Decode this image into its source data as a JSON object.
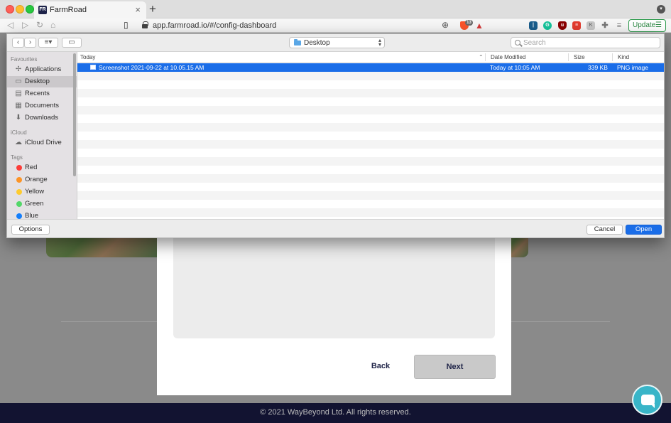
{
  "browser": {
    "tab": {
      "favicon": "FR",
      "title": "FarmRoad",
      "close": "×"
    },
    "new_tab": "+",
    "url": "app.farmroad.io/#/config-dashboard",
    "brave_badge": "13",
    "update_label": "Update",
    "update_menu": "☰"
  },
  "dialog": {
    "location": "Desktop",
    "search_placeholder": "Search",
    "sidebar": {
      "favourites_heading": "Favourites",
      "favourites": [
        {
          "label": "Applications",
          "icon": "applications-icon"
        },
        {
          "label": "Desktop",
          "icon": "desktop-icon",
          "selected": true
        },
        {
          "label": "Recents",
          "icon": "recents-icon"
        },
        {
          "label": "Documents",
          "icon": "documents-icon"
        },
        {
          "label": "Downloads",
          "icon": "downloads-icon"
        }
      ],
      "icloud_heading": "iCloud",
      "icloud": [
        {
          "label": "iCloud Drive",
          "icon": "cloud-icon"
        }
      ],
      "tags_heading": "Tags",
      "tags": [
        {
          "label": "Red",
          "color": "#fc3d39"
        },
        {
          "label": "Orange",
          "color": "#fd9426"
        },
        {
          "label": "Yellow",
          "color": "#fecb2e"
        },
        {
          "label": "Green",
          "color": "#53d769"
        },
        {
          "label": "Blue",
          "color": "#147efb"
        }
      ]
    },
    "columns": {
      "name": "Today",
      "modified": "Date Modified",
      "size": "Size",
      "kind": "Kind"
    },
    "files": [
      {
        "name": "Screenshot 2021-09-22 at 10.05.15 AM",
        "modified": "Today at 10:05 AM",
        "size": "339 KB",
        "kind": "PNG image",
        "selected": true
      }
    ],
    "options_label": "Options",
    "cancel_label": "Cancel",
    "open_label": "Open"
  },
  "page": {
    "back_label": "Back",
    "next_label": "Next",
    "footer_text": "© 2021 WayBeyond Ltd. All rights reserved."
  },
  "colors": {
    "selection": "#1a6de8",
    "footer_bg": "#121331",
    "chat_bg": "#39b5c8"
  }
}
